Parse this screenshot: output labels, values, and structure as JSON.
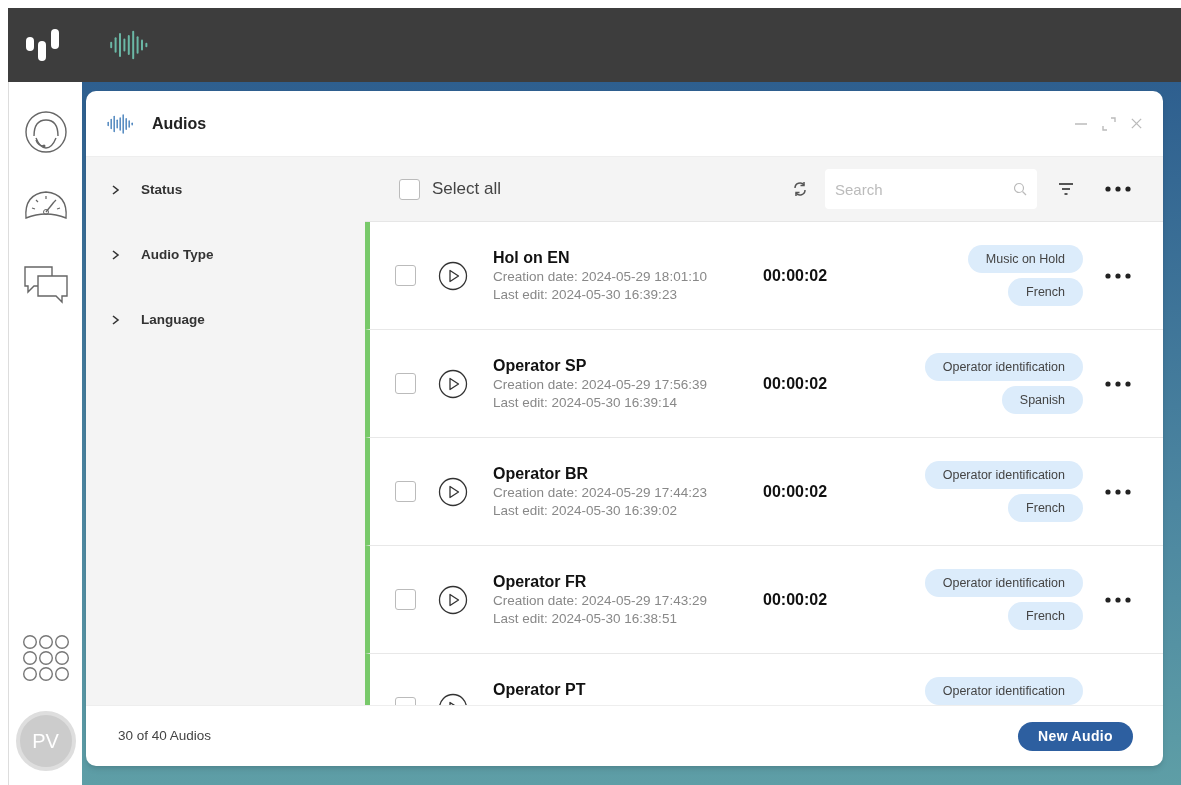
{
  "window": {
    "title": "Audios"
  },
  "filters": [
    {
      "label": "Status",
      "expanded": false
    },
    {
      "label": "Audio Type",
      "expanded": false
    },
    {
      "label": "Language",
      "expanded": false
    }
  ],
  "toolbar": {
    "select_all": {
      "label": "Select all",
      "checked": false
    },
    "search": {
      "placeholder": "Search"
    }
  },
  "audios": [
    {
      "name": "Hol on EN",
      "created": "Creation date: 2024-05-29 18:01:10",
      "edited": "Last edit: 2024-05-30 16:39:23",
      "duration": "00:00:02",
      "tags": [
        "Music on Hold",
        "French"
      ],
      "checked": false
    },
    {
      "name": "Operator SP",
      "created": "Creation date: 2024-05-29 17:56:39",
      "edited": "Last edit: 2024-05-30 16:39:14",
      "duration": "00:00:02",
      "tags": [
        "Operator identification",
        "Spanish"
      ],
      "checked": false
    },
    {
      "name": "Operator BR",
      "created": "Creation date: 2024-05-29 17:44:23",
      "edited": "Last edit: 2024-05-30 16:39:02",
      "duration": "00:00:02",
      "tags": [
        "Operator identification",
        "French"
      ],
      "checked": false
    },
    {
      "name": "Operator FR",
      "created": "Creation date: 2024-05-29 17:43:29",
      "edited": "Last edit: 2024-05-30 16:38:51",
      "duration": "00:00:02",
      "tags": [
        "Operator identification",
        "French"
      ],
      "checked": false
    },
    {
      "name": "Operator PT",
      "tags": [
        "Operator identification"
      ],
      "checked": false
    }
  ],
  "footer": {
    "count": "30 of 40 Audios",
    "new_button": "New Audio"
  },
  "user": {
    "initials": "PV"
  }
}
